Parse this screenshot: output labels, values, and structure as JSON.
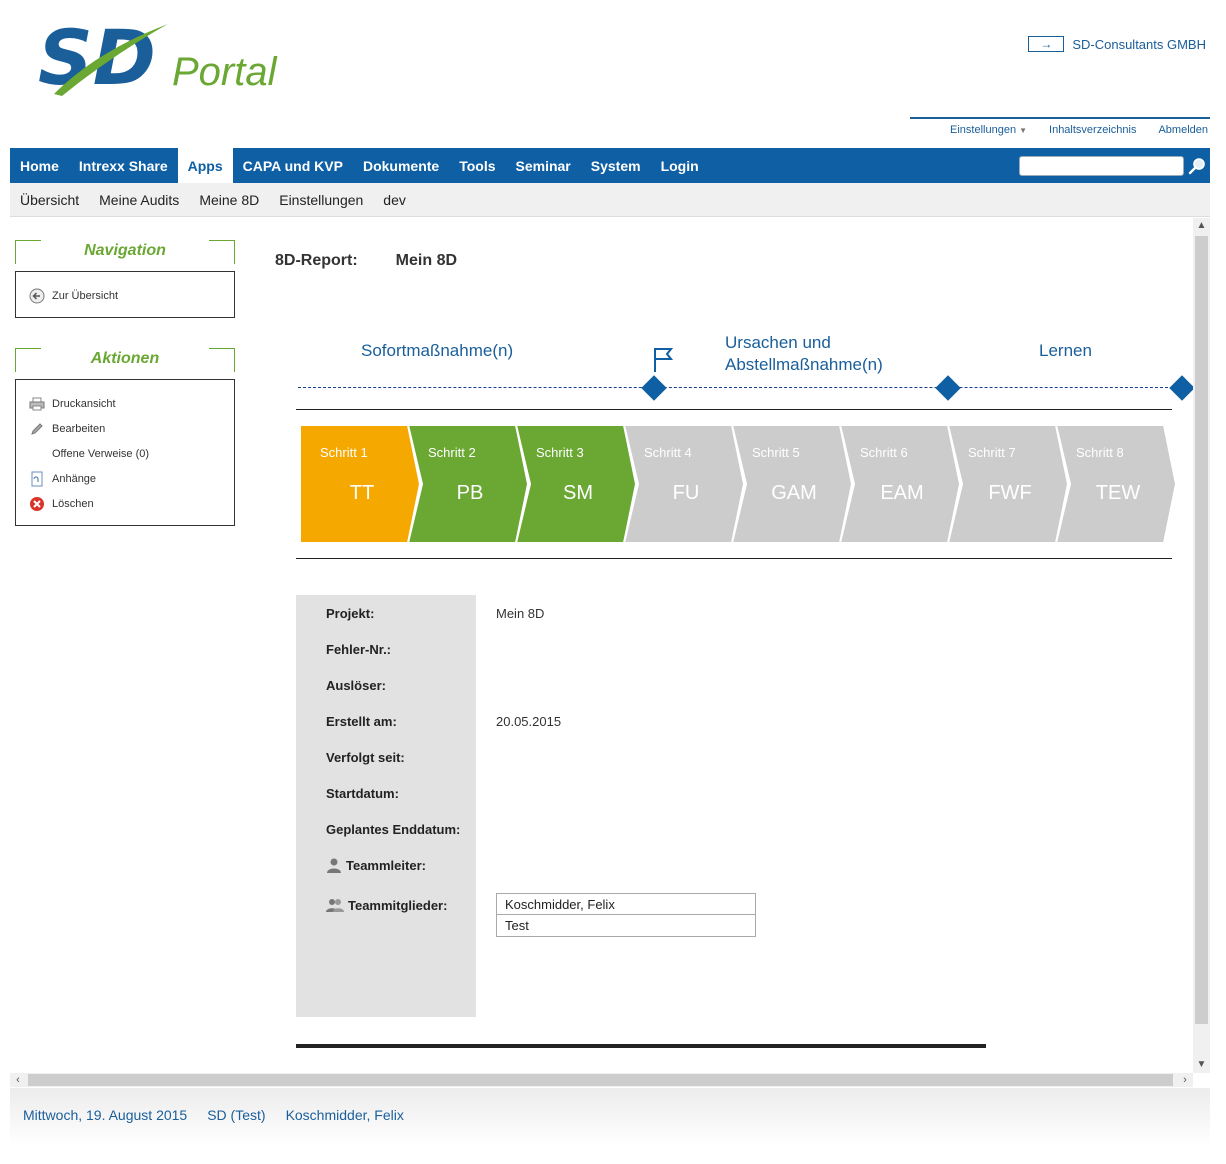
{
  "header": {
    "portal_text": "Portal",
    "company": "SD-Consultants GMBH",
    "links": [
      {
        "label": "Einstellungen"
      },
      {
        "label": "Inhaltsverzeichnis"
      },
      {
        "label": "Abmelden"
      }
    ]
  },
  "mainnav": {
    "items": [
      "Home",
      "Intrexx Share",
      "Apps",
      "CAPA und KVP",
      "Dokumente",
      "Tools",
      "Seminar",
      "System",
      "Login"
    ],
    "active": "Apps",
    "search_value": ""
  },
  "subnav": {
    "items": [
      "Übersicht",
      "Meine Audits",
      "Meine 8D",
      "Einstellungen",
      "dev"
    ]
  },
  "navigation_panel": {
    "title": "Navigation",
    "items": [
      {
        "label": "Zur Übersicht",
        "icon": "back-arrow-icon"
      }
    ]
  },
  "actions_panel": {
    "title": "Aktionen",
    "items": [
      {
        "label": "Druckansicht",
        "icon": "printer-icon"
      },
      {
        "label": "Bearbeiten",
        "icon": "pencil-icon"
      },
      {
        "label": "Offene Verweise (0)",
        "icon": ""
      },
      {
        "label": "Anhänge",
        "icon": "attachment-icon"
      },
      {
        "label": "Löschen",
        "icon": "delete-icon"
      }
    ]
  },
  "report": {
    "label": "8D-Report:",
    "name": "Mein 8D"
  },
  "phases": {
    "first": "Sofortmaßnahme(n)",
    "second_line1": "Ursachen und",
    "second_line2": "Abstellmaßnahme(n)",
    "third": "Lernen"
  },
  "steps": [
    {
      "step": "Schritt 1",
      "code": "TT",
      "status": "current",
      "color": "#f5a800"
    },
    {
      "step": "Schritt 2",
      "code": "PB",
      "status": "done",
      "color": "#6aa733"
    },
    {
      "step": "Schritt 3",
      "code": "SM",
      "status": "done",
      "color": "#6aa733"
    },
    {
      "step": "Schritt 4",
      "code": "FU",
      "status": "open",
      "color": "#cccccc"
    },
    {
      "step": "Schritt 5",
      "code": "GAM",
      "status": "open",
      "color": "#cccccc"
    },
    {
      "step": "Schritt 6",
      "code": "EAM",
      "status": "open",
      "color": "#cccccc"
    },
    {
      "step": "Schritt 7",
      "code": "FWF",
      "status": "open",
      "color": "#cccccc"
    },
    {
      "step": "Schritt 8",
      "code": "TEW",
      "status": "open",
      "color": "#cccccc"
    }
  ],
  "info": {
    "projekt_label": "Projekt:",
    "projekt_value": "Mein 8D",
    "fehler_label": "Fehler-Nr.:",
    "fehler_value": "",
    "ausloeser_label": "Auslöser:",
    "ausloeser_value": "",
    "erstellt_label": "Erstellt am:",
    "erstellt_value": "20.05.2015",
    "verfolgt_label": "Verfolgt seit:",
    "verfolgt_value": "",
    "start_label": "Startdatum:",
    "start_value": "",
    "ende_label": "Geplantes Enddatum:",
    "ende_value": "",
    "teamleiter_label": "Teammleiter:",
    "teamleiter_value": "",
    "mitglieder_label": "Teammitglieder:",
    "mitglieder": [
      "Koschmidder, Felix",
      "Test"
    ]
  },
  "footer": {
    "date": "Mittwoch, 19. August 2015",
    "org": "SD (Test)",
    "user": "Koschmidder, Felix"
  },
  "colors": {
    "brand_blue": "#0e5fa3",
    "brand_green": "#6aa733",
    "step_current": "#f5a800",
    "step_open": "#cccccc"
  }
}
